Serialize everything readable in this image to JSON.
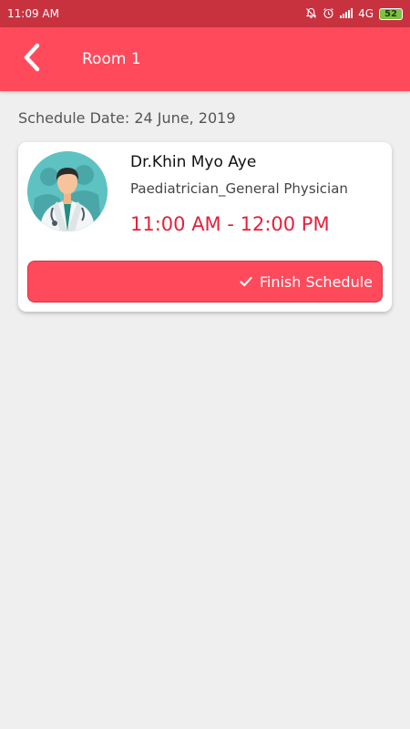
{
  "status_bar": {
    "time": "11:09 AM",
    "icons": [
      "mute-bell-icon",
      "alarm-icon",
      "signal-icon",
      "network-4g-icon"
    ],
    "network": "4G",
    "battery": "52"
  },
  "app_bar": {
    "back_icon": "chevron-left-icon",
    "title": "Room 1",
    "color": "#ff4a5c"
  },
  "schedule": {
    "date_label": "Schedule Date: 24 June, 2019"
  },
  "doctor_card": {
    "avatar_icon": "doctor-avatar-icon",
    "name": "Dr.Khin Myo Aye",
    "specialty": "Paediatrician_General Physician",
    "time_range": "11:00 AM - 12:00 PM",
    "time_color": "#e8203a",
    "finish_button": {
      "icon": "check-icon",
      "label": "Finish Schedule"
    }
  }
}
